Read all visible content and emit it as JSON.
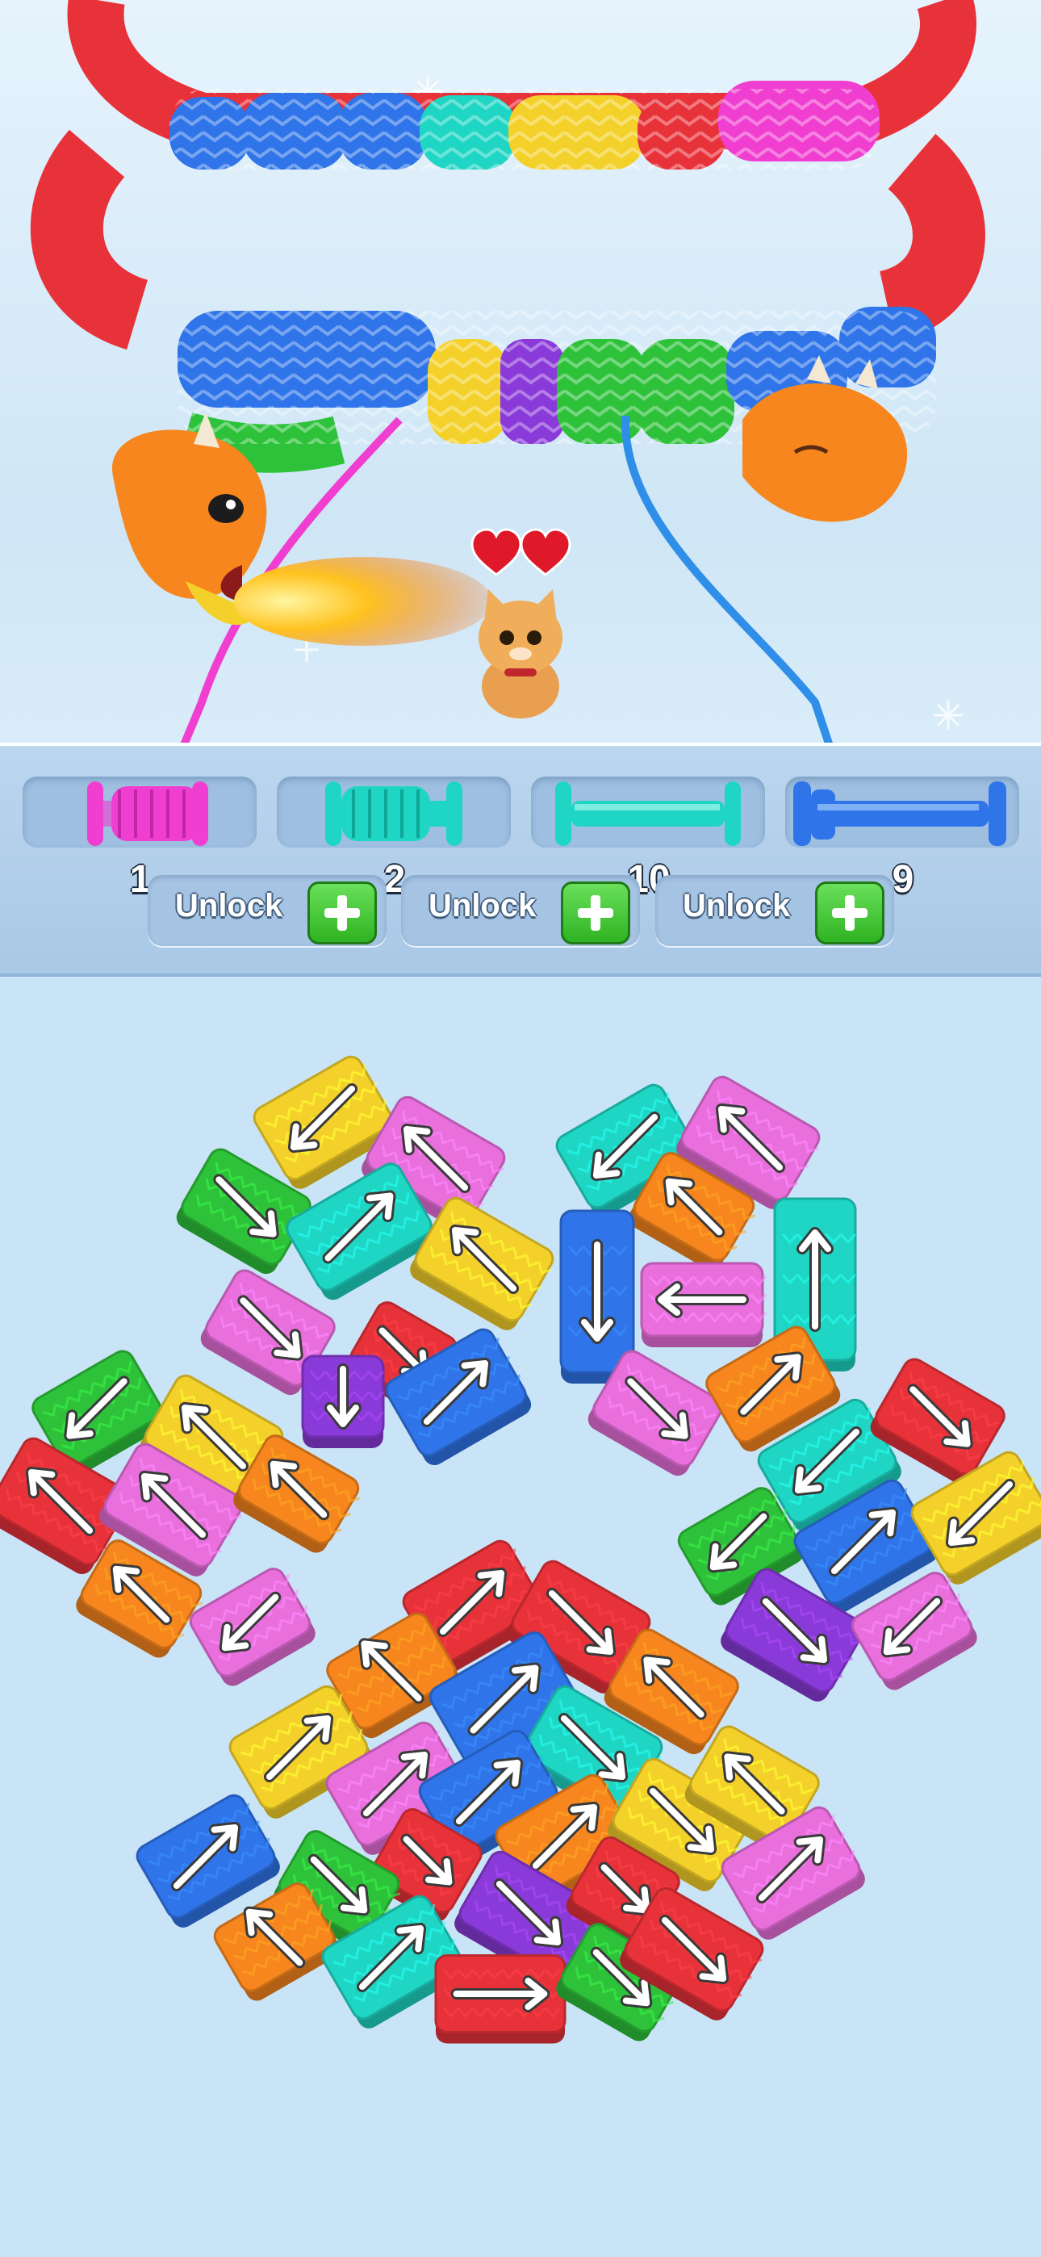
{
  "colors": {
    "magenta": "#f03fd0",
    "cyan": "#1fd6c4",
    "blue": "#2f74e8",
    "red": "#e8323a",
    "yellow": "#f4d12a",
    "green": "#2ec23a",
    "orange": "#f6861d",
    "purple": "#8a3ad8",
    "pink": "#e86fdc"
  },
  "scene": {
    "hearts": 2,
    "characters": [
      "dragon-icon",
      "cat-icon"
    ]
  },
  "spools": [
    {
      "color": "magenta",
      "count": "1",
      "filled": true
    },
    {
      "color": "cyan",
      "count": "2",
      "filled": true
    },
    {
      "color": "cyan",
      "count": "10",
      "filled": false
    },
    {
      "color": "blue",
      "count": "9",
      "filled": true
    }
  ],
  "unlock_buttons": [
    {
      "label": "Unlock",
      "icon": "plus-icon"
    },
    {
      "label": "Unlock",
      "icon": "plus-icon"
    },
    {
      "label": "Unlock",
      "icon": "plus-icon"
    }
  ],
  "blocks": [
    {
      "color": "yellow",
      "dir": "down-left"
    },
    {
      "color": "pink",
      "dir": "up-left"
    },
    {
      "color": "green",
      "dir": "down-right"
    },
    {
      "color": "cyan",
      "dir": "up-right"
    },
    {
      "color": "yellow",
      "dir": "up-left"
    },
    {
      "color": "pink",
      "dir": "down-right"
    },
    {
      "color": "red",
      "dir": "down-right"
    },
    {
      "color": "purple",
      "dir": "down"
    },
    {
      "color": "blue",
      "dir": "up-right"
    },
    {
      "color": "cyan",
      "dir": "down-left"
    },
    {
      "color": "pink",
      "dir": "up-left"
    },
    {
      "color": "orange",
      "dir": "up-left"
    },
    {
      "color": "blue",
      "dir": "down"
    },
    {
      "color": "pink",
      "dir": "left"
    },
    {
      "color": "cyan",
      "dir": "up"
    },
    {
      "color": "pink",
      "dir": "down-right"
    },
    {
      "color": "orange",
      "dir": "up-right"
    },
    {
      "color": "green",
      "dir": "down-left"
    },
    {
      "color": "yellow",
      "dir": "up-left"
    },
    {
      "color": "red",
      "dir": "up-left"
    },
    {
      "color": "pink",
      "dir": "up-left"
    },
    {
      "color": "orange",
      "dir": "up-left"
    },
    {
      "color": "orange",
      "dir": "up-left"
    },
    {
      "color": "pink",
      "dir": "down-left"
    },
    {
      "color": "cyan",
      "dir": "down-left"
    },
    {
      "color": "red",
      "dir": "down-right"
    },
    {
      "color": "green",
      "dir": "down-left"
    },
    {
      "color": "blue",
      "dir": "up-right"
    },
    {
      "color": "yellow",
      "dir": "down-left"
    },
    {
      "color": "purple",
      "dir": "down-right"
    },
    {
      "color": "pink",
      "dir": "down-left"
    },
    {
      "color": "red",
      "dir": "up-right"
    },
    {
      "color": "red",
      "dir": "down-right"
    },
    {
      "color": "orange",
      "dir": "up-left"
    },
    {
      "color": "blue",
      "dir": "up-right"
    },
    {
      "color": "orange",
      "dir": "up-left"
    },
    {
      "color": "cyan",
      "dir": "down-right"
    },
    {
      "color": "yellow",
      "dir": "up-right"
    },
    {
      "color": "pink",
      "dir": "up-right"
    },
    {
      "color": "blue",
      "dir": "up-right"
    },
    {
      "color": "orange",
      "dir": "up-right"
    },
    {
      "color": "yellow",
      "dir": "down-right"
    },
    {
      "color": "yellow",
      "dir": "up-left"
    },
    {
      "color": "blue",
      "dir": "up-right"
    },
    {
      "color": "red",
      "dir": "down-right"
    },
    {
      "color": "green",
      "dir": "down-right"
    },
    {
      "color": "purple",
      "dir": "down-right"
    },
    {
      "color": "red",
      "dir": "down-right"
    },
    {
      "color": "pink",
      "dir": "up-right"
    },
    {
      "color": "orange",
      "dir": "up-left"
    },
    {
      "color": "cyan",
      "dir": "up-right"
    },
    {
      "color": "red",
      "dir": "right"
    },
    {
      "color": "green",
      "dir": "down-right"
    },
    {
      "color": "red",
      "dir": "down-right"
    }
  ]
}
